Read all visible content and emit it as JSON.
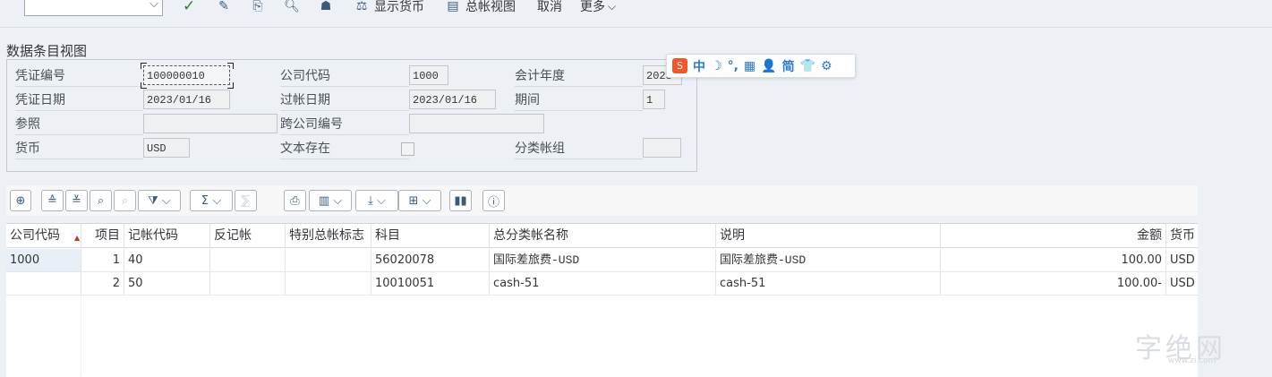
{
  "toolbar": {
    "command_field": "",
    "show_currency": "显示货币",
    "gl_view": "总帐视图",
    "cancel": "取消",
    "more": "更多"
  },
  "section_title": "数据条目视图",
  "header": {
    "doc_no_label": "凭证编号",
    "doc_no": "100000010",
    "company_code_label": "公司代码",
    "company_code": "1000",
    "fiscal_year_label": "会计年度",
    "fiscal_year": "2023",
    "doc_date_label": "凭证日期",
    "doc_date": "2023/01/16",
    "posting_date_label": "过帐日期",
    "posting_date": "2023/01/16",
    "period_label": "期间",
    "period": "1",
    "reference_label": "参照",
    "reference": "",
    "cross_company_label": "跨公司编号",
    "cross_company": "",
    "currency_label": "货币",
    "currency": "USD",
    "text_exists_label": "文本存在",
    "ledger_group_label": "分类帐组",
    "ledger_group": ""
  },
  "ime_bar": {
    "logo": "S",
    "items": [
      "中",
      "☽",
      "°,",
      "▦",
      "👤",
      "简",
      "👕",
      "⚙"
    ]
  },
  "table": {
    "columns": [
      "公司代码",
      "项目",
      "记帐代码",
      "反记帐",
      "特别总帐标志",
      "科目",
      "总分类帐名称",
      "说明",
      "金额",
      "货币"
    ],
    "rows": [
      [
        "1000",
        "1",
        "40",
        "",
        "",
        "56020078",
        "国际差旅费-USD",
        "国际差旅费-USD",
        "100.00",
        "USD"
      ],
      [
        "",
        "2",
        "50",
        "",
        "",
        "10010051",
        "cash-51",
        "cash-51",
        "100.00-",
        "USD"
      ]
    ]
  },
  "watermark": "字绝网",
  "watermark_sub": "www.zi.com"
}
